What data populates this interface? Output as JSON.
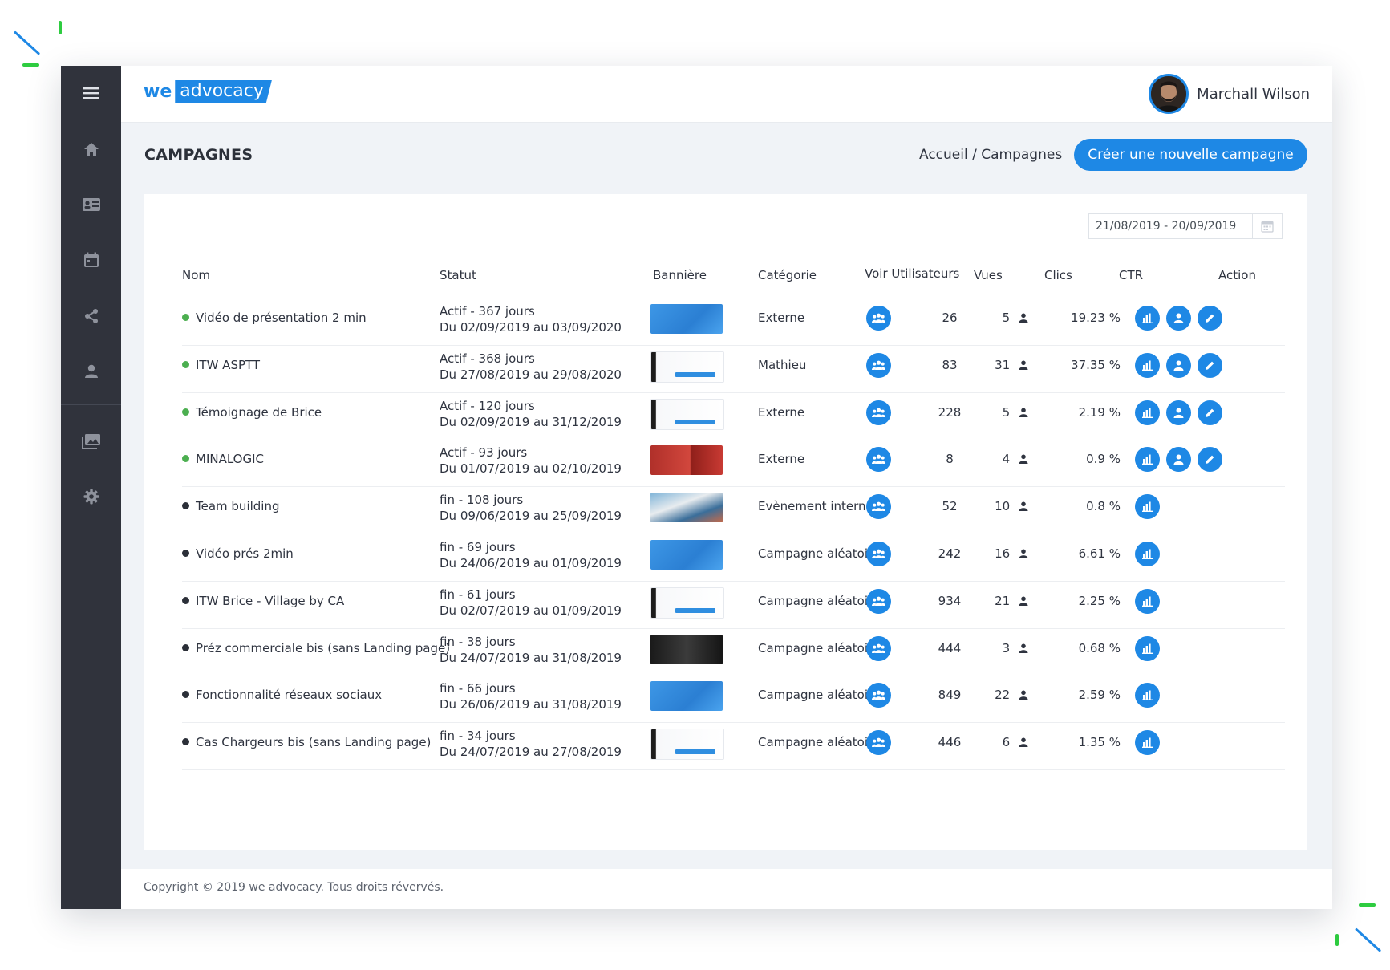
{
  "app": {
    "logo_we": "we",
    "logo_advocacy": "advocacy",
    "user_name": "Marchall Wilson"
  },
  "sidebar": {
    "items": [
      {
        "icon": "menu-icon"
      },
      {
        "icon": "home-icon"
      },
      {
        "icon": "id-card-icon"
      },
      {
        "icon": "calendar-icon"
      },
      {
        "icon": "share-icon"
      },
      {
        "icon": "user-icon"
      },
      {
        "icon": "gallery-icon"
      },
      {
        "icon": "gear-icon"
      }
    ]
  },
  "page": {
    "title": "CAMPAGNES",
    "breadcrumb": "Accueil / Campagnes",
    "create_button": "Créer une nouvelle campagne",
    "date_range": "21/08/2019 - 20/09/2019"
  },
  "table": {
    "headers": {
      "nom": "Nom",
      "statut": "Statut",
      "banniere": "Bannière",
      "categorie": "Catégorie",
      "voir": "Voir Utilisateurs",
      "vues": "Vues",
      "clics": "Clics",
      "ctr": "CTR",
      "action": "Action"
    },
    "rows": [
      {
        "name": "Vidéo de présentation 2 min",
        "active": true,
        "status": "Actif - 367 jours",
        "dates": "Du 02/09/2019 au 03/09/2020",
        "banner": "blue",
        "category": "Externe",
        "vues": "26",
        "clics": "5",
        "ctr": "19.23 %"
      },
      {
        "name": "ITW ASPTT",
        "active": true,
        "status": "Actif - 368 jours",
        "dates": "Du 27/08/2019 au 29/08/2020",
        "banner": "white",
        "category": "Mathieu",
        "vues": "83",
        "clics": "31",
        "ctr": "37.35 %"
      },
      {
        "name": "Témoignage de Brice",
        "active": true,
        "status": "Actif - 120 jours",
        "dates": "Du 02/09/2019 au 31/12/2019",
        "banner": "white",
        "category": "Externe",
        "vues": "228",
        "clics": "5",
        "ctr": "2.19 %"
      },
      {
        "name": "MINALOGIC",
        "active": true,
        "status": "Actif - 93 jours",
        "dates": "Du 01/07/2019 au 02/10/2019",
        "banner": "red",
        "category": "Externe",
        "vues": "8",
        "clics": "4",
        "ctr": "0.9 %"
      },
      {
        "name": "Team building",
        "active": false,
        "status": "fin - 108 jours",
        "dates": "Du 09/06/2019 au 25/09/2019",
        "banner": "photo",
        "category": "Evènement interne",
        "vues": "52",
        "clics": "10",
        "ctr": "0.8 %"
      },
      {
        "name": "Vidéo prés 2min",
        "active": false,
        "status": "fin - 69 jours",
        "dates": "Du 24/06/2019 au 01/09/2019",
        "banner": "blue",
        "category": "Campagne aléatoire",
        "vues": "242",
        "clics": "16",
        "ctr": "6.61 %"
      },
      {
        "name": "ITW Brice - Village by CA",
        "active": false,
        "status": "fin - 61 jours",
        "dates": "Du 02/07/2019 au 01/09/2019",
        "banner": "white",
        "category": "Campagne aléatoire",
        "vues": "934",
        "clics": "21",
        "ctr": "2.25 %"
      },
      {
        "name": "Préz commerciale bis (sans Landing page)",
        "active": false,
        "status": "fin - 38 jours",
        "dates": "Du 24/07/2019 au 31/08/2019",
        "banner": "dark",
        "category": "Campagne aléatoire",
        "vues": "444",
        "clics": "3",
        "ctr": "0.68 %"
      },
      {
        "name": "Fonctionnalité réseaux sociaux",
        "active": false,
        "status": "fin - 66 jours",
        "dates": "Du 26/06/2019 au 31/08/2019",
        "banner": "blue",
        "category": "Campagne aléatoire",
        "vues": "849",
        "clics": "22",
        "ctr": "2.59 %"
      },
      {
        "name": "Cas Chargeurs bis (sans Landing page)",
        "active": false,
        "status": "fin - 34 jours",
        "dates": "Du 24/07/2019 au 27/08/2019",
        "banner": "white",
        "category": "Campagne aléatoire",
        "vues": "446",
        "clics": "6",
        "ctr": "1.35 %"
      }
    ]
  },
  "footer": {
    "text": "Copyright © 2019 we advocacy. Tous droits révervés."
  },
  "colors": {
    "accent": "#1e88e5",
    "sidebar": "#30333c",
    "active_dot": "#4caf50",
    "inactive_dot": "#2b2f38"
  }
}
